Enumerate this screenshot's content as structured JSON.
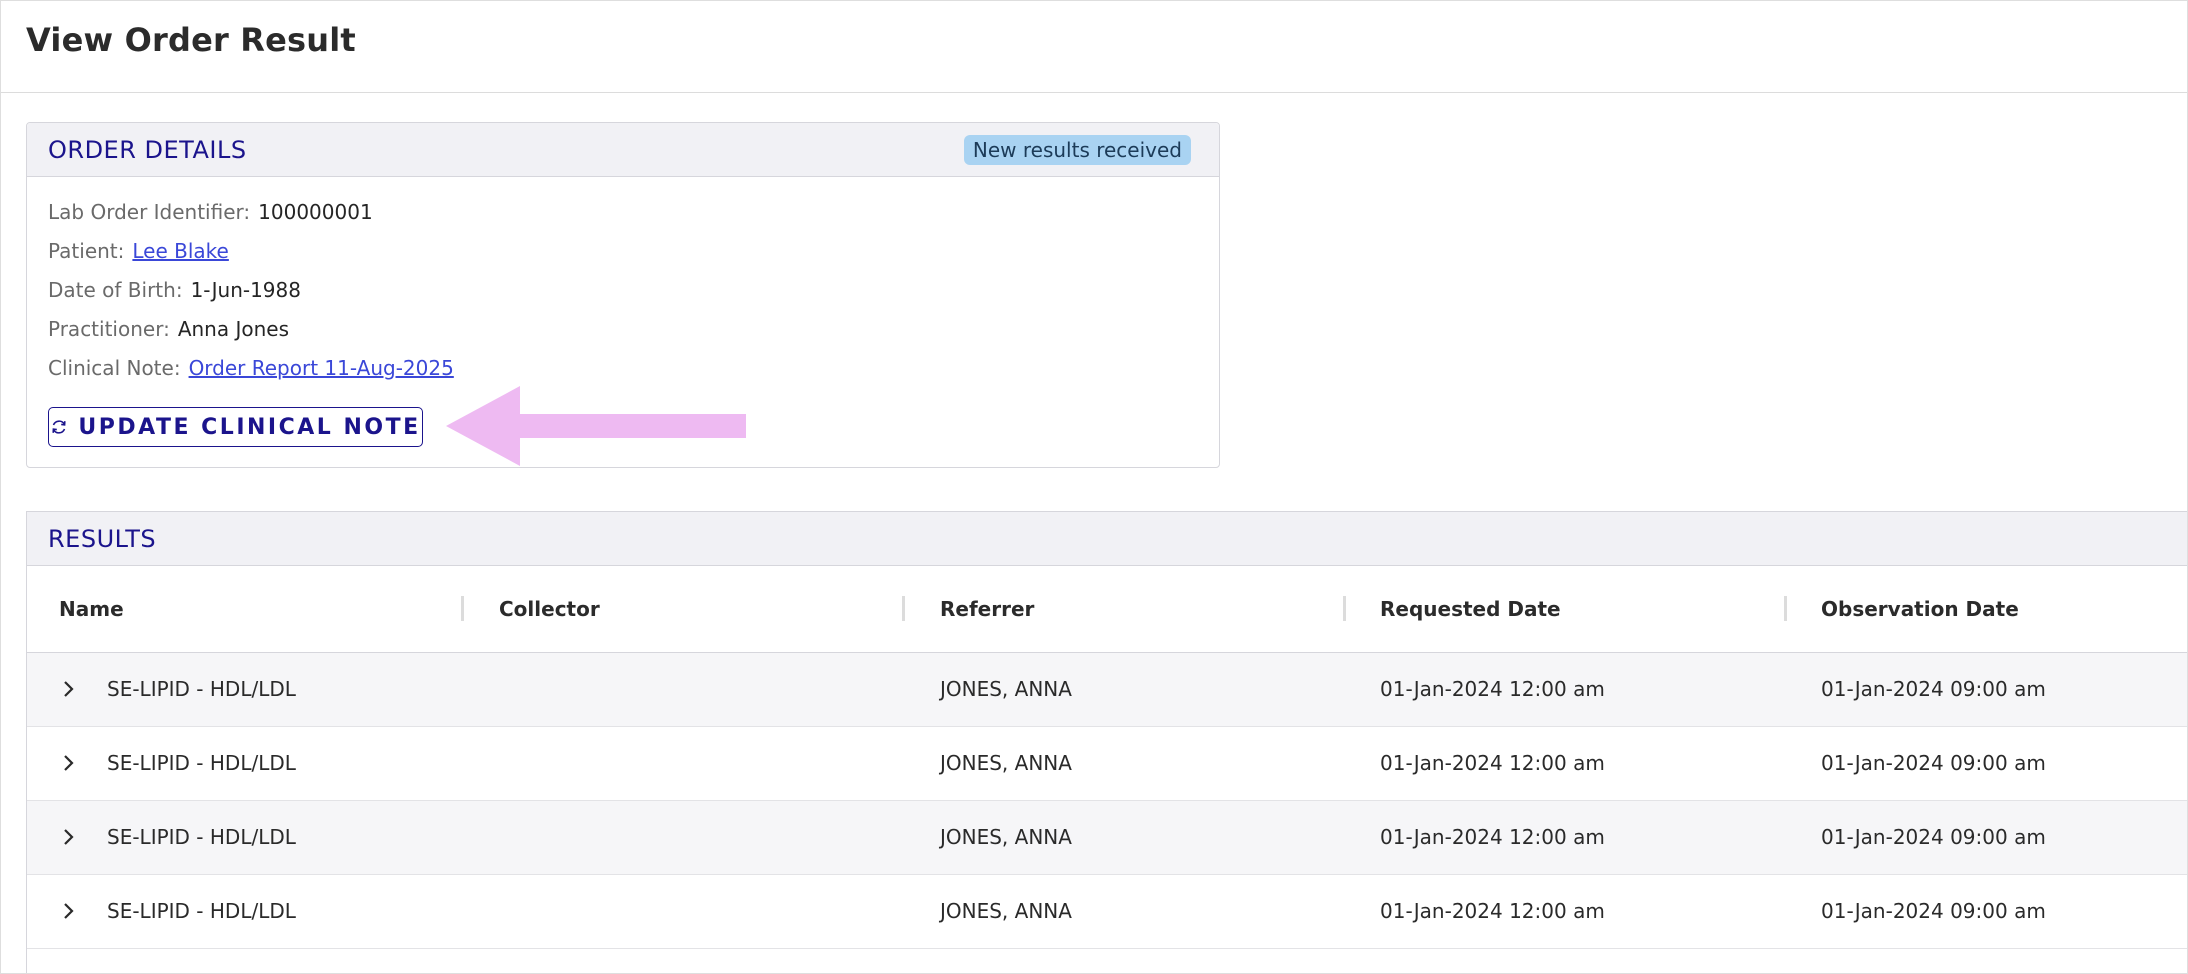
{
  "page": {
    "title": "View Order Result"
  },
  "order_details": {
    "title": "ORDER DETAILS",
    "badge": "New results received",
    "fields": {
      "lab_order_identifier": {
        "label": "Lab Order Identifier:",
        "value": "100000001"
      },
      "patient": {
        "label": "Patient:",
        "value": "Lee Blake"
      },
      "date_of_birth": {
        "label": "Date of Birth:",
        "value": "1-Jun-1988"
      },
      "practitioner": {
        "label": "Practitioner:",
        "value": "Anna Jones"
      },
      "clinical_note": {
        "label": "Clinical Note:",
        "value": "Order Report 11-Aug-2025"
      }
    },
    "update_button_label": "UPDATE CLINICAL NOTE",
    "update_button_icon": "refresh-icon"
  },
  "annotation": {
    "arrow_color": "#eebaf2",
    "arrow_icon": "left-arrow-pointer"
  },
  "results": {
    "title": "RESULTS",
    "columns": [
      "Name",
      "Collector",
      "Referrer",
      "Requested Date",
      "Observation Date"
    ],
    "rows": [
      {
        "name": "SE-LIPID - HDL/LDL",
        "collector": "",
        "referrer": "JONES, ANNA",
        "requested_date": "01-Jan-2024 12:00 am",
        "observation_date": "01-Jan-2024 09:00 am"
      },
      {
        "name": "SE-LIPID - HDL/LDL",
        "collector": "",
        "referrer": "JONES, ANNA",
        "requested_date": "01-Jan-2024 12:00 am",
        "observation_date": "01-Jan-2024 09:00 am"
      },
      {
        "name": "SE-LIPID - HDL/LDL",
        "collector": "",
        "referrer": "JONES, ANNA",
        "requested_date": "01-Jan-2024 12:00 am",
        "observation_date": "01-Jan-2024 09:00 am"
      },
      {
        "name": "SE-LIPID - HDL/LDL",
        "collector": "",
        "referrer": "JONES, ANNA",
        "requested_date": "01-Jan-2024 12:00 am",
        "observation_date": "01-Jan-2024 09:00 am"
      }
    ],
    "row_expand_icon": "chevron-right-icon"
  },
  "colors": {
    "accent": "#1b148c",
    "link": "#3a47d8",
    "badge_bg": "#a9d3f2",
    "header_bg": "#f1f1f5"
  }
}
